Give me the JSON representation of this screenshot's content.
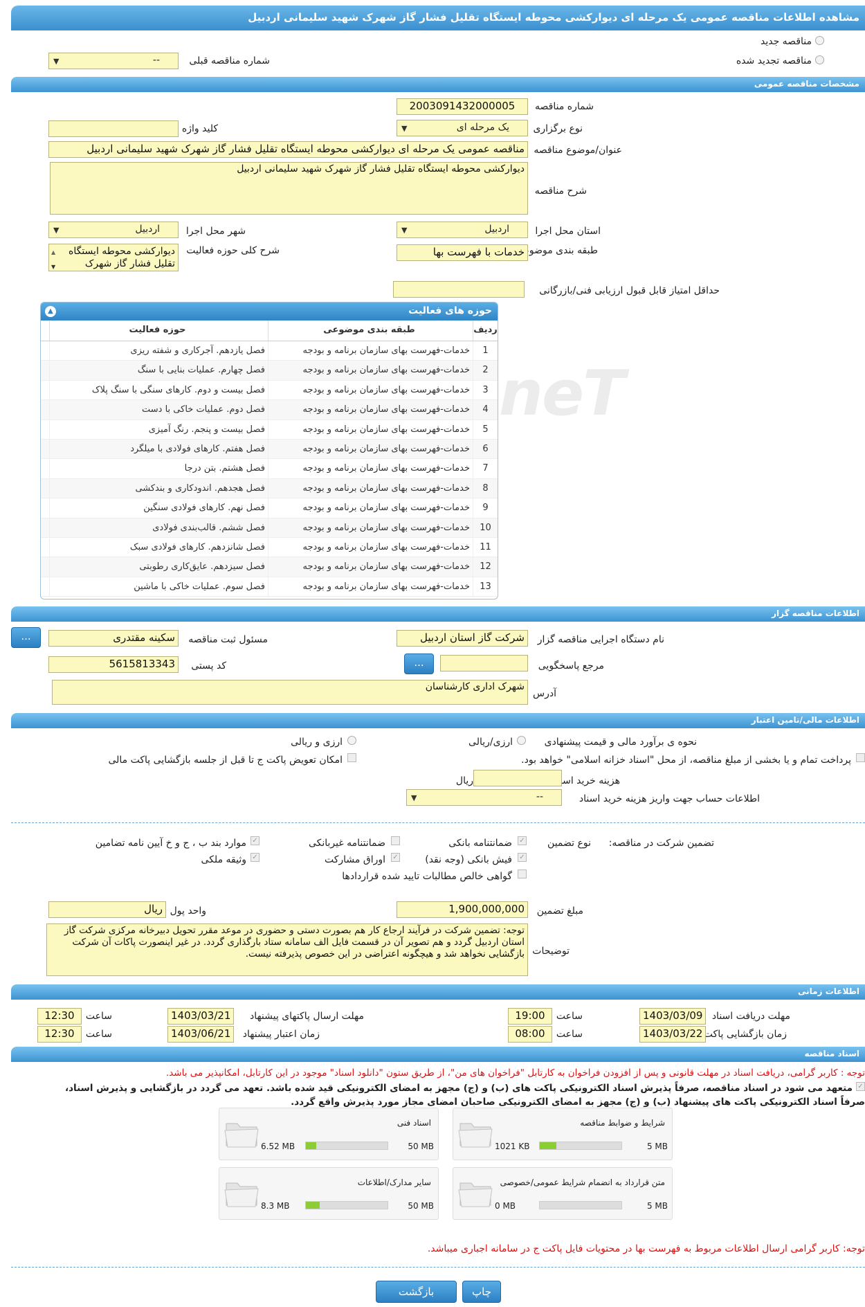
{
  "title": "مشاهده اطلاعات مناقصه عمومی یک مرحله ای دیوارکشی محوطه ایستگاه تقلیل فشار گاز شهرک شهید سلیمانی اردبیل",
  "top": {
    "radio_new": "مناقصه جدید",
    "radio_renew": "مناقصه تجدید شده",
    "prev_number_label": "شماره مناقصه قبلی",
    "prev_number_value": "--"
  },
  "general": {
    "section_title": "مشخصات مناقصه عمومی",
    "number_label": "شماره مناقصه",
    "number_value": "2003091432000005",
    "keyword_label": "کلید واژه",
    "keyword_value": "",
    "type_label": "نوع برگزاری",
    "type_value": "یک مرحله ای",
    "subject_label": "عنوان/موضوع مناقصه",
    "subject_value": "مناقصه عمومی یک مرحله ای دیوارکشی محوطه ایستگاه تقلیل فشار گاز شهرک شهید سلیمانی اردبیل",
    "desc_label": "شرح مناقصه",
    "desc_value": "دیوارکشی محوطه ایستگاه تقلیل فشار گاز شهرک شهید سلیمانی اردبیل",
    "province_label": "استان محل اجرا",
    "province_value": "اردبیل",
    "city_label": "شهر محل اجرا",
    "city_value": "اردبیل",
    "category_label": "طبقه بندی موضوعی",
    "category_value": "خدمات با فهرست بها",
    "scope_label": "شرح کلی حوزه فعالیت",
    "scope_value": "دیوارکشی محوطه ایستگاه تقلیل فشار گاز شهرک",
    "min_score_label": "حداقل امتیاز قابل قبول ارزیابی فنی/بازرگانی",
    "min_score_value": ""
  },
  "activities": {
    "title": "حوزه های فعالیت",
    "col_row": "ردیف",
    "col_category": "طبقه بندی موضوعی",
    "col_area": "حوزه فعالیت",
    "rows": [
      {
        "n": "1",
        "cat": "خدمات-فهرست بهای سازمان برنامه و بودجه",
        "area": "فصل یازدهم. آجرکاری و شفته ریزی"
      },
      {
        "n": "2",
        "cat": "خدمات-فهرست بهای سازمان برنامه و بودجه",
        "area": "فصل چهارم. عملیات بنایی با سنگ"
      },
      {
        "n": "3",
        "cat": "خدمات-فهرست بهای سازمان برنامه و بودجه",
        "area": "فصل بیست و دوم. کارهای سنگی با سنگ پلاک"
      },
      {
        "n": "4",
        "cat": "خدمات-فهرست بهای سازمان برنامه و بودجه",
        "area": "فصل دوم. عملیات خاکی با دست"
      },
      {
        "n": "5",
        "cat": "خدمات-فهرست بهای سازمان برنامه و بودجه",
        "area": "فصل بیست و پنجم. رنگ آمیزی"
      },
      {
        "n": "6",
        "cat": "خدمات-فهرست بهای سازمان برنامه و بودجه",
        "area": "فصل هفتم. کارهای فولادی با میلگرد"
      },
      {
        "n": "7",
        "cat": "خدمات-فهرست بهای سازمان برنامه و بودجه",
        "area": "فصل هشتم. بتن درجا"
      },
      {
        "n": "8",
        "cat": "خدمات-فهرست بهای سازمان برنامه و بودجه",
        "area": "فصل هجدهم. اندودکاری و بندکشی"
      },
      {
        "n": "9",
        "cat": "خدمات-فهرست بهای سازمان برنامه و بودجه",
        "area": "فصل نهم. کارهای فولادی سنگین"
      },
      {
        "n": "10",
        "cat": "خدمات-فهرست بهای سازمان برنامه و بودجه",
        "area": "فصل ششم. قالب‌بندی فولادی"
      },
      {
        "n": "11",
        "cat": "خدمات-فهرست بهای سازمان برنامه و بودجه",
        "area": "فصل شانزدهم. کارهای فولادی سبک"
      },
      {
        "n": "12",
        "cat": "خدمات-فهرست بهای سازمان برنامه و بودجه",
        "area": "فصل سیزدهم. عایق‌کاری رطوبتی"
      },
      {
        "n": "13",
        "cat": "خدمات-فهرست بهای سازمان برنامه و بودجه",
        "area": "فصل سوم. عملیات خاکی با ماشین"
      }
    ]
  },
  "organizer": {
    "section_title": "اطلاعات مناقصه گزار",
    "org_label": "نام دستگاه اجرایی مناقصه گزار",
    "org_value": "شرکت گاز استان اردبیل",
    "officer_label": "مسئول ثبت مناقصه",
    "officer_value": "سکینه  مقتدری",
    "ref_label": "مرجع پاسخگویی",
    "ref_value": "",
    "postal_label": "کد پستی",
    "postal_value": "5615813343",
    "address_label": "آدرس",
    "address_value": "شهرک اداری کارشناسان",
    "dots": "..."
  },
  "finance": {
    "section_title": "اطلاعات مالی/تامین اعتبار",
    "estimate_label": "نحوه ی برآورد مالی و قیمت پیشنهادی",
    "opt_currency_rial": "ارزی/ریالی",
    "opt_currency_and_rial": "ارزی و ریالی",
    "treasury_text": "پرداخت تمام و یا بخشی از مبلغ مناقصه، از محل \"اسناد خزانه اسلامی\" خواهد بود.",
    "swap_text": "امکان تعویض پاکت ج تا قبل از جلسه بازگشایی پاکت مالی",
    "doc_cost_label": "هزینه خرید اسناد",
    "doc_cost_value": "",
    "doc_cost_unit": "ریال",
    "account_label": "اطلاعات حساب جهت واریز هزینه خرید اسناد",
    "account_value": "--",
    "guarantee_label": "تضمین شرکت در مناقصه:",
    "guarantee_type_label": "نوع تضمین",
    "g_bank": "ضمانتنامه بانکی",
    "g_nonbank": "ضمانتنامه غیربانکی",
    "g_misc": "موارد بند ب ، ج و خ آیین نامه تضامین",
    "g_cheque": "فیش بانکی (وجه نقد)",
    "g_bonds": "اوراق مشارکت",
    "g_property": "وثیقه ملکی",
    "g_claims": "گواهی خالص مطالبات تایید شده قراردادها",
    "amount_label": "مبلغ تضمین",
    "amount_value": "1,900,000,000",
    "unit_label": "واحد پول",
    "unit_value": "ریال",
    "notes_label": "توضیحات",
    "notes_value": "توجه: تضمین شرکت در فرآیند ارجاع کار هم بصورت دستی و حضوری در موعد مقرر تحویل دبیرخانه مرکزی شرکت گاز استان اردبیل گردد و هم تصویر آن در قسمت فایل الف سامانه ستاد بارگذاری گردد. در غیر اینصورت پاکات آن شرکت بازگشایی نخواهد شد و هیچگونه اعتراضی در این خصوص پذیرفته نیست."
  },
  "timing": {
    "section_title": "اطلاعات زمانی",
    "receive_label": "مهلت دریافت اسناد",
    "receive_date": "1403/03/09",
    "receive_time": "19:00",
    "send_label": "مهلت ارسال پاکتهای پیشنهاد",
    "send_date": "1403/03/21",
    "send_time": "12:30",
    "open_label": "زمان بازگشایی پاکت ها",
    "open_date": "1403/03/22",
    "open_time": "08:00",
    "validity_label": "زمان اعتبار پیشنهاد",
    "validity_date": "1403/06/21",
    "validity_time": "12:30",
    "time_label": "ساعت"
  },
  "documents": {
    "section_title": "اسناد مناقصه",
    "notice": "توجه : کاربر گرامی، دریافت اسناد در مهلت قانونی و پس از افزودن فراخوان به کارتابل \"فراخوان های من\"، از طریق ستون \"دانلود اسناد\" موجود در این کارتابل، امکانپذیر می باشد.",
    "commit_line1": "متعهد می شود در اسناد مناقصه، صرفاً پذیرش اسناد الکترونیکی پاکت های (ب) و (ج) مجهز به امضای الکترونیکی قید شده باشد. تعهد می گردد در بازگشایی و پذیرش اسناد،",
    "commit_line2": "صرفاً اسناد الکترونیکی پاکت های پیشنهاد (ب) و (ج) مجهز به امضای الکترونیکی صاحبان امضای مجاز مورد پذیرش واقع گردد.",
    "files": [
      {
        "name": "شرایط و ضوابط مناقصه",
        "max": "5 MB",
        "size": "1021 KB",
        "fill": 0.2
      },
      {
        "name": "اسناد فنی",
        "max": "50 MB",
        "size": "6.52 MB",
        "fill": 0.13
      },
      {
        "name": "متن قرارداد به انضمام شرایط عمومی/خصوصی",
        "max": "5 MB",
        "size": "0 MB",
        "fill": 0.0
      },
      {
        "name": "سایر مدارک/اطلاعات",
        "max": "50 MB",
        "size": "8.3 MB",
        "fill": 0.17
      }
    ],
    "footer_notice": "توجه: کاربر گرامی ارسال اطلاعات مربوط به فهرست بها در محتویات فایل پاکت ج در سامانه اجباری میباشد."
  },
  "buttons": {
    "print": "چاپ",
    "back": "بازگشت"
  },
  "watermark": "iriaTender.neT",
  "colors": {
    "accent": "#3b8fcf",
    "input_bg": "#fbf9c0",
    "warning": "#dd1111",
    "progress": "#8ccc34"
  }
}
